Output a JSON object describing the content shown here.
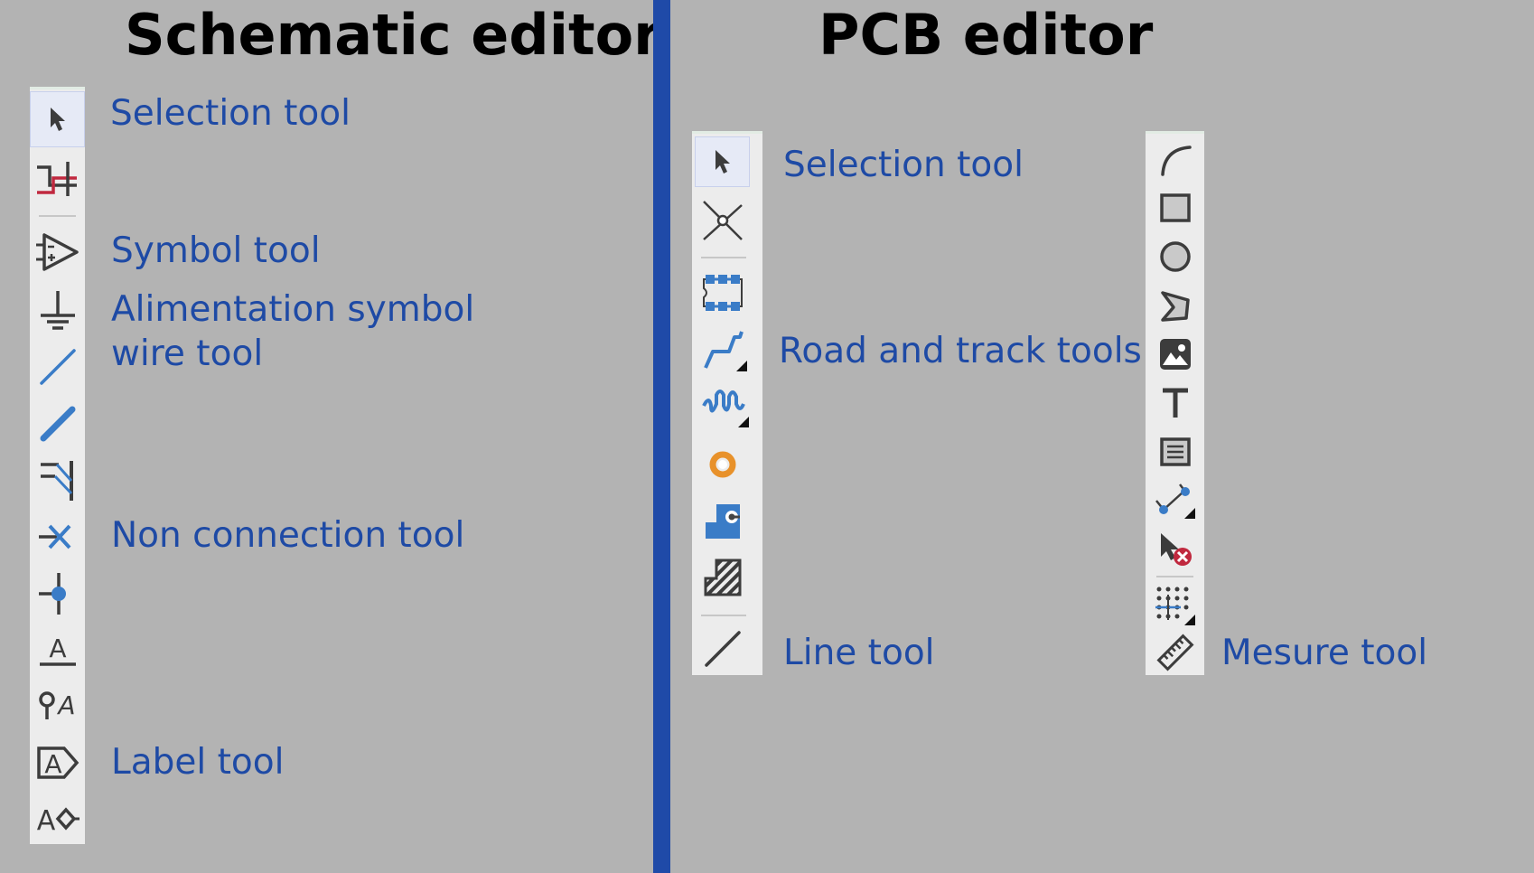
{
  "colors": {
    "background": "#b3b3b3",
    "divider": "#1f4aa8",
    "label_text": "#1e4aa5",
    "heading_text": "#000000",
    "toolbar_bg": "#ececec",
    "icon_dark": "#3c3c3c",
    "icon_blue": "#3a7cc7",
    "icon_red": "#c0283e",
    "icon_orange": "#e8912a"
  },
  "schematic": {
    "title": "Schematic editor",
    "toolbar": {
      "tools": [
        {
          "icon": "selection-arrow-icon",
          "active": true
        },
        {
          "icon": "highlight-net-icon"
        },
        {
          "icon": "symbol-opamp-icon"
        },
        {
          "icon": "power-ground-icon"
        },
        {
          "icon": "wire-icon"
        },
        {
          "icon": "bus-icon"
        },
        {
          "icon": "bus-entry-icon"
        },
        {
          "icon": "no-connect-icon"
        },
        {
          "icon": "junction-icon"
        },
        {
          "icon": "net-label-icon"
        },
        {
          "icon": "global-label-pin-icon"
        },
        {
          "icon": "hierarchical-label-icon"
        },
        {
          "icon": "label-diamond-icon"
        }
      ]
    },
    "labels": {
      "selection": "Selection tool",
      "symbol": "Symbol tool",
      "alimentation": "Alimentation symbol",
      "wire": "wire tool",
      "non_connection": "Non connection tool",
      "label": "Label tool"
    }
  },
  "pcb": {
    "title": "PCB editor",
    "left_toolbar": {
      "tools": [
        {
          "icon": "selection-arrow-icon",
          "active": true
        },
        {
          "icon": "local-ratsnest-icon"
        },
        {
          "icon": "footprint-icon"
        },
        {
          "icon": "route-track-icon",
          "has_submenu": true
        },
        {
          "icon": "tune-length-icon",
          "has_submenu": true
        },
        {
          "icon": "via-icon"
        },
        {
          "icon": "filled-zone-icon"
        },
        {
          "icon": "rule-area-icon"
        },
        {
          "icon": "graphic-line-icon"
        }
      ]
    },
    "right_toolbar": {
      "tools": [
        {
          "icon": "arc-icon"
        },
        {
          "icon": "rectangle-icon"
        },
        {
          "icon": "circle-icon"
        },
        {
          "icon": "polygon-icon"
        },
        {
          "icon": "image-icon"
        },
        {
          "icon": "text-icon"
        },
        {
          "icon": "textbox-icon"
        },
        {
          "icon": "dimension-icon",
          "has_submenu": true
        },
        {
          "icon": "delete-tool-icon"
        },
        {
          "icon": "grid-origin-icon",
          "has_submenu": true
        },
        {
          "icon": "measure-ruler-icon"
        }
      ]
    },
    "labels": {
      "selection": "Selection tool",
      "road_track": "Road and track tools",
      "line": "Line tool",
      "measure": "Mesure tool"
    }
  }
}
